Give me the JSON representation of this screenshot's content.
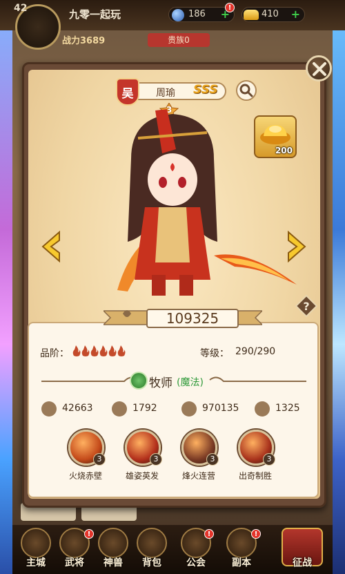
{
  "top_bar": {
    "level": "42",
    "player_name": "九零一起玩",
    "gems": "186",
    "gold": "410",
    "power_label": "战力",
    "power_value": "3689",
    "rank_label": "贵族0"
  },
  "hero": {
    "faction": "吴",
    "name": "周瑜",
    "grade": "SSS",
    "stars": "3",
    "combat_power": "109325",
    "quality_label": "品阶：",
    "quality_level": 6,
    "level_label": "等级：",
    "level_value": "290/290",
    "class_name": "牧师",
    "class_type": "(魔法)",
    "stats": [
      {
        "icon": "sword-icon",
        "value": "42663"
      },
      {
        "icon": "shield-icon",
        "value": "1792"
      },
      {
        "icon": "heart-icon",
        "value": "970135"
      },
      {
        "icon": "boot-icon",
        "value": "1325"
      }
    ],
    "skills": [
      {
        "name": "火烧赤壁",
        "level": "3",
        "color": "#c44a1a"
      },
      {
        "name": "雄姿英发",
        "level": "3",
        "color": "#b3301c"
      },
      {
        "name": "烽火连营",
        "level": "3",
        "color": "#7a3a24"
      },
      {
        "name": "出奇制胜",
        "level": "3",
        "color": "#a8321c"
      }
    ]
  },
  "reward": {
    "qty": "200"
  },
  "bottom_nav": [
    {
      "label": "主城"
    },
    {
      "label": "武将"
    },
    {
      "label": "神兽"
    },
    {
      "label": "背包"
    },
    {
      "label": "公会"
    },
    {
      "label": "副本"
    },
    {
      "label": "征战"
    }
  ],
  "colors": {
    "accent_red": "#c4352a",
    "grade_gold": "#e8a21c",
    "class_green": "#2f9a3a",
    "panel_bg": "#fdf6ea"
  }
}
